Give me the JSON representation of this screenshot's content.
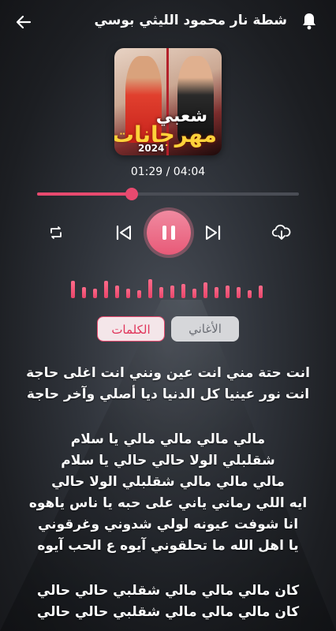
{
  "header": {
    "title": "شطة نار محمود الليثي بوسي",
    "back_icon": "arrow-left-icon",
    "notification_icon": "bell-icon"
  },
  "cover": {
    "top_text": "شعبي",
    "main_text": "مهرجانات",
    "year": "2024"
  },
  "player": {
    "time_display": "01:29 / 04:04",
    "progress_fraction": 0.36,
    "accent_color": "#e84a6f",
    "controls": [
      "repeat-icon",
      "previous-icon",
      "pause-icon",
      "next-icon",
      "download-icon"
    ]
  },
  "equalizer": {
    "levels": [
      0.55,
      0.35,
      0.3,
      0.55,
      0.4,
      0.3,
      0.25,
      0.6,
      0.35,
      0.4,
      0.45,
      0.3,
      0.5,
      0.35,
      0.4,
      0.35,
      0.25,
      0.4
    ]
  },
  "tabs": {
    "lyrics": "الكلمات",
    "songs": "الأغاني",
    "active": "lyrics"
  },
  "lyrics": {
    "lines": [
      "انت حتة مني انت عين ونني انت اغلى حاجة",
      "انت نور عينيا كل الدنيا ديا أصلي وآخر حاجة",
      "",
      "مالي مالي مالي مالي يا سلام",
      "شقلبلي الولا حالي حالي يا سلام",
      "مالي مالي مالي شقلبلي الولا حالي",
      "ايه اللي رماني ياني على حبه يا ناس ياهوه",
      "انا شوفت عيونه لولي شدوني وغرقوني",
      "يا اهل الله ما تحلقوني آيوه ع الحب آيوه",
      "",
      "كان مالي مالي مالي شقلبي حالي حالي",
      "كان مالي مالي مالي شقلبي حالي حالي"
    ]
  }
}
